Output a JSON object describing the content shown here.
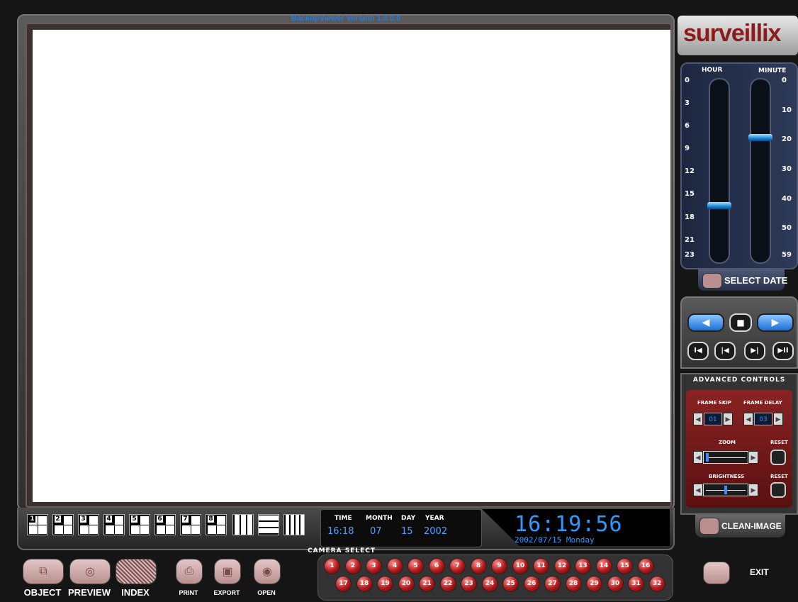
{
  "window": {
    "title": "BackupViewer Version 1.0.0.0"
  },
  "logo": {
    "text": "surveillix"
  },
  "time_selector": {
    "hour_label": "HOUR",
    "minute_label": "MINUTE",
    "hour_ticks": [
      "0",
      "3",
      "6",
      "9",
      "12",
      "15",
      "18",
      "21",
      "23"
    ],
    "minute_ticks": [
      "0",
      "10",
      "20",
      "30",
      "40",
      "50",
      "59"
    ],
    "hour_value": 16,
    "minute_value": 18,
    "select_date_label": "SELECT DATE"
  },
  "split_buttons": [
    "1",
    "2",
    "3",
    "4",
    "5",
    "6",
    "7",
    "8",
    "9-grid",
    "9-grid-b",
    "16-grid"
  ],
  "datetime": {
    "time_label": "TIME",
    "month_label": "MONTH",
    "day_label": "DAY",
    "year_label": "YEAR",
    "time": "16:18",
    "month": "07",
    "day": "15",
    "year": "2002"
  },
  "clock": {
    "time": "16:19:56",
    "date": "2002/07/15 Monday"
  },
  "camera_select": {
    "title": "CAMERA SELECT",
    "cameras": [
      "1",
      "2",
      "3",
      "4",
      "5",
      "6",
      "7",
      "8",
      "9",
      "10",
      "11",
      "12",
      "13",
      "14",
      "15",
      "16",
      "17",
      "18",
      "19",
      "20",
      "21",
      "22",
      "23",
      "24",
      "25",
      "26",
      "27",
      "28",
      "29",
      "30",
      "31",
      "32"
    ]
  },
  "toolbar": {
    "object_label": "OBJECT",
    "preview_label": "PREVIEW",
    "index_label": "INDEX",
    "print_label": "PRINT",
    "export_label": "EXPORT",
    "open_label": "OPEN"
  },
  "advanced": {
    "title": "ADVANCED CONTROLS",
    "frame_skip_label": "FRAME SKIP",
    "frame_delay_label": "FRAME DELAY",
    "frame_skip_value": "01",
    "frame_delay_value": "03",
    "zoom_label": "ZOOM",
    "brightness_label": "BRIGHTNESS",
    "reset_label": "RESET",
    "zoom_level": 0.0,
    "brightness_level": 0.5
  },
  "clean_image_label": "CLEAN-IMAGE",
  "exit_label": "EXIT",
  "colors": {
    "accent_blue": "#2a9bff",
    "camera_red": "#b01818",
    "panel_red": "#8a2323"
  }
}
